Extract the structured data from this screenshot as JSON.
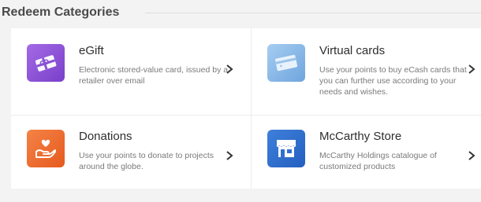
{
  "section": {
    "title": "Redeem Categories"
  },
  "cards": [
    {
      "title": "eGift",
      "description": "Electronic stored-value card, issued by a retailer over email",
      "icon": "gift-card-icon",
      "color": "#8a4fd6"
    },
    {
      "title": "Virtual cards",
      "description": "Use your points to buy eCash cards that you can further use according to your needs and wishes.",
      "icon": "credit-card-icon",
      "color": "#7fb2e6"
    },
    {
      "title": "Donations",
      "description": "Use your points to donate to projects around the globe.",
      "icon": "heart-hand-icon",
      "color": "#ef6a2d"
    },
    {
      "title": "McCarthy Store",
      "description": "McCarthy Holdings catalogue of customized products",
      "icon": "storefront-icon",
      "color": "#2f6fd0"
    }
  ]
}
